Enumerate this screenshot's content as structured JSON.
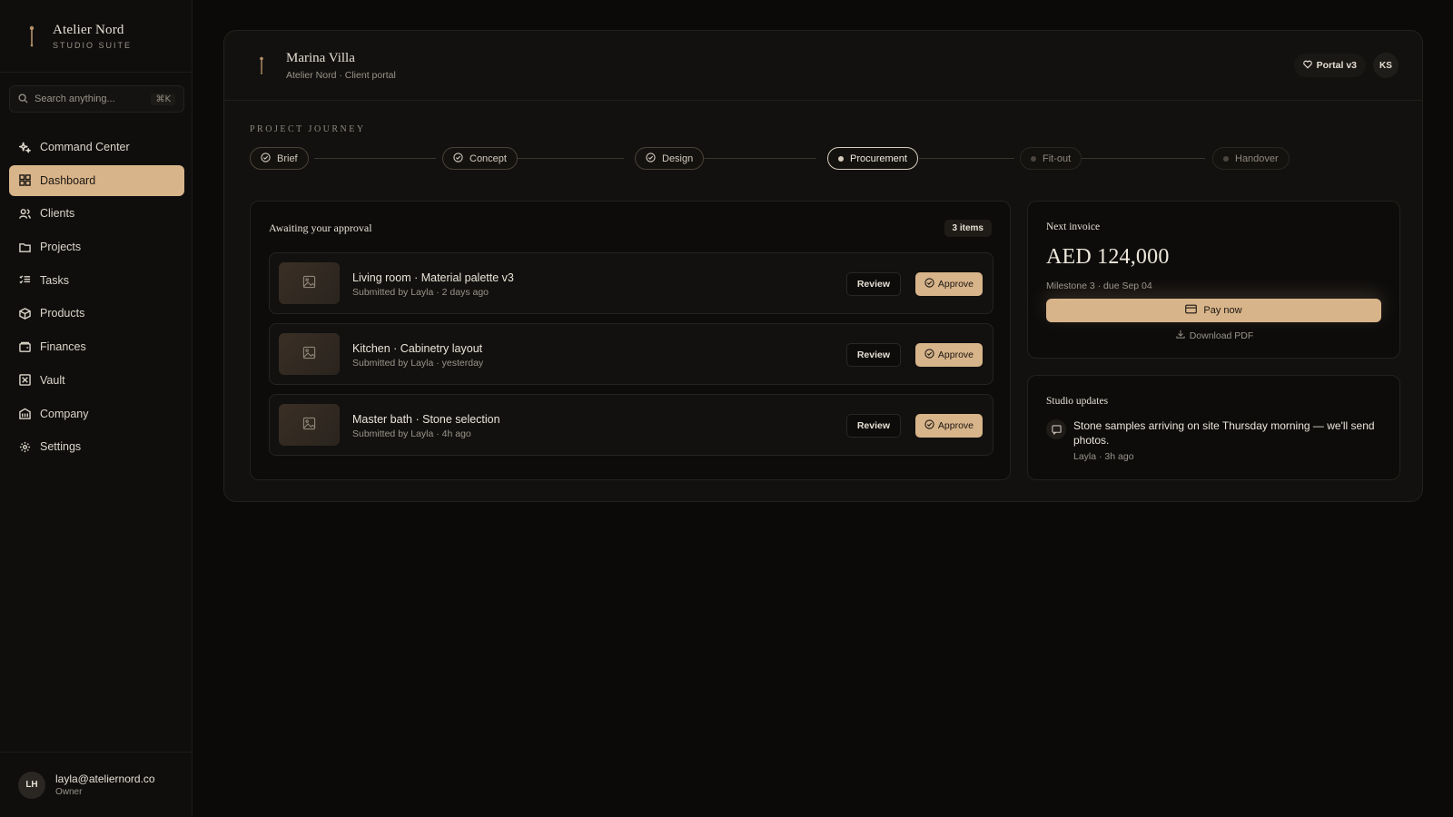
{
  "brand": {
    "name": "Atelier Nord",
    "subtitle": "STUDIO SUITE"
  },
  "search": {
    "placeholder": "Search anything...",
    "shortcut": "⌘K"
  },
  "sidebar": {
    "items": [
      {
        "label": "Command Center",
        "icon": "sparkle-icon"
      },
      {
        "label": "Dashboard",
        "icon": "grid-icon",
        "active": true
      },
      {
        "label": "Clients",
        "icon": "users-icon"
      },
      {
        "label": "Projects",
        "icon": "folder-icon"
      },
      {
        "label": "Tasks",
        "icon": "list-check-icon"
      },
      {
        "label": "Products",
        "icon": "box-icon"
      },
      {
        "label": "Finances",
        "icon": "wallet-icon"
      },
      {
        "label": "Vault",
        "icon": "vault-icon"
      },
      {
        "label": "Company",
        "icon": "building-icon"
      },
      {
        "label": "Settings",
        "icon": "gear-icon"
      }
    ]
  },
  "user": {
    "initials": "LH",
    "email": "layla@ateliernord.co",
    "role": "Owner"
  },
  "header": {
    "title": "Marina Villa",
    "subtitle": "Atelier Nord · Client portal",
    "badge": "Portal v3",
    "avatar": "KS"
  },
  "journey": {
    "label": "PROJECT JOURNEY",
    "steps": [
      {
        "label": "Brief",
        "state": "done"
      },
      {
        "label": "Concept",
        "state": "done"
      },
      {
        "label": "Design",
        "state": "done"
      },
      {
        "label": "Procurement",
        "state": "current"
      },
      {
        "label": "Fit-out",
        "state": "todo"
      },
      {
        "label": "Handover",
        "state": "todo"
      }
    ]
  },
  "approvals": {
    "title": "Awaiting your approval",
    "count": "3 items",
    "review_label": "Review",
    "approve_label": "Approve",
    "items": [
      {
        "title": "Living room · Material palette v3",
        "meta": "Submitted by Layla · 2 days ago"
      },
      {
        "title": "Kitchen · Cabinetry layout",
        "meta": "Submitted by Layla · yesterday"
      },
      {
        "title": "Master bath · Stone selection",
        "meta": "Submitted by Layla · 4h ago"
      }
    ]
  },
  "invoice": {
    "title": "Next invoice",
    "amount": "AED 124,000",
    "meta": "Milestone 3 · due Sep 04",
    "pay_label": "Pay now",
    "download_label": "Download PDF"
  },
  "updates": {
    "title": "Studio updates",
    "message": "Stone samples arriving on site Thursday morning — we'll send photos.",
    "meta": "Layla · 3h ago"
  },
  "colors": {
    "accent": "#d8b48a",
    "background": "#0b0a09",
    "panel": "#12110f"
  }
}
